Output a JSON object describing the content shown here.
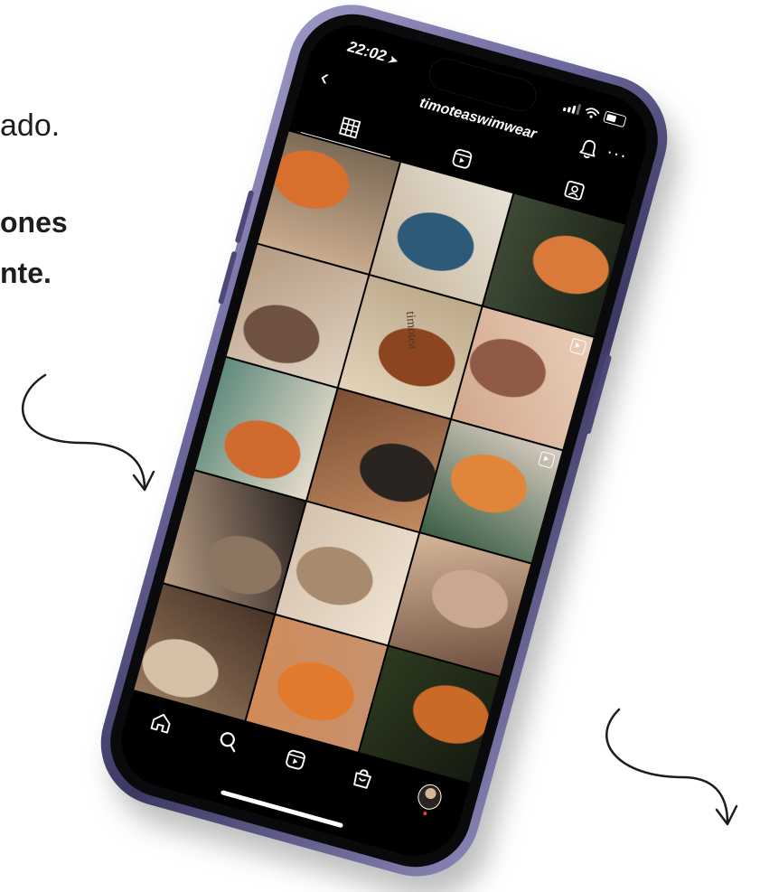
{
  "background_text": {
    "line1": "ado.",
    "line2": "ones",
    "line3": "nte."
  },
  "status_bar": {
    "time": "22:02",
    "location_icon": "location-arrow-icon",
    "signal_icon": "cellular-signal-icon",
    "wifi_icon": "wifi-icon",
    "battery_icon": "battery-icon"
  },
  "header": {
    "back_icon": "chevron-left-icon",
    "username": "timoteaswimwear",
    "bell_icon": "bell-icon",
    "more_icon": "more-horizontal-icon"
  },
  "tabs": [
    {
      "icon": "grid-icon",
      "active": true
    },
    {
      "icon": "reels-icon",
      "active": false
    },
    {
      "icon": "tagged-icon",
      "active": false
    }
  ],
  "grid_tiles": [
    {
      "name": "orange-bikini-wrap",
      "colors": [
        "#c9ab8e",
        "#d86f2d",
        "#7d6b57"
      ]
    },
    {
      "name": "ocean-terrace",
      "colors": [
        "#c5b49a",
        "#2e5a7a",
        "#e8e3d8"
      ]
    },
    {
      "name": "orange-set-garden",
      "colors": [
        "#3e4a35",
        "#d97a3a",
        "#1c2318"
      ]
    },
    {
      "name": "mirror-selfie",
      "colors": [
        "#b49a81",
        "#6e5140",
        "#e1d3c2"
      ]
    },
    {
      "name": "timotea-tote",
      "colors": [
        "#e2d3b8",
        "#8c4520",
        "#bda98a"
      ],
      "text": "timotea"
    },
    {
      "name": "pattern-wrap",
      "colors": [
        "#d2a88c",
        "#8f5a46",
        "#e9cdb8"
      ],
      "reel": true
    },
    {
      "name": "pool-lounge",
      "colors": [
        "#5e8a7c",
        "#d06a2e",
        "#e6dccb"
      ]
    },
    {
      "name": "beach-belly",
      "colors": [
        "#7b4f33",
        "#2a2420",
        "#c18a60"
      ]
    },
    {
      "name": "poolside-drink",
      "colors": [
        "#3b5f45",
        "#e0853a",
        "#d7cbbf"
      ],
      "reel": true
    },
    {
      "name": "knit-set",
      "colors": [
        "#b59b83",
        "#8c7662",
        "#2a2320"
      ]
    },
    {
      "name": "two-friends",
      "colors": [
        "#d4c2ad",
        "#a88a6e",
        "#efe3d3"
      ]
    },
    {
      "name": "pattern-top",
      "colors": [
        "#d6b69a",
        "#caa78f",
        "#6b4e3c"
      ]
    },
    {
      "name": "doorway-pose",
      "colors": [
        "#9a7a5e",
        "#d5c0a8",
        "#463327"
      ]
    },
    {
      "name": "tie-front-bikini",
      "colors": [
        "#d28a55",
        "#e17a2c",
        "#c79270"
      ]
    },
    {
      "name": "orange-bag-palms",
      "colors": [
        "#2d3a1f",
        "#c96a28",
        "#151a10"
      ]
    }
  ],
  "bottom_nav": [
    {
      "icon": "home-icon"
    },
    {
      "icon": "search-icon"
    },
    {
      "icon": "reels-icon"
    },
    {
      "icon": "shop-icon"
    },
    {
      "icon": "profile-avatar"
    }
  ]
}
